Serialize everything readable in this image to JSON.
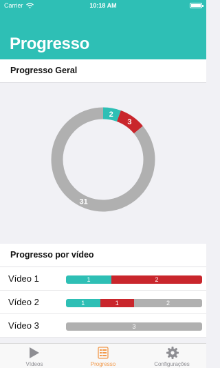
{
  "status_bar": {
    "carrier": "Carrier",
    "time": "10:18 AM"
  },
  "header": {
    "title": "Progresso"
  },
  "overall": {
    "title": "Progresso Geral",
    "segments": [
      {
        "value": 2,
        "label": "2",
        "color": "#2ebfb5"
      },
      {
        "value": 3,
        "label": "3",
        "color": "#c9262c"
      },
      {
        "value": 31,
        "label": "31",
        "color": "#b0b0b0"
      }
    ]
  },
  "videos": {
    "title": "Progresso por vídeo",
    "items": [
      {
        "label": "Vídeo 1",
        "segments": [
          {
            "value": 1,
            "label": "1",
            "color": "#2ebfb5"
          },
          {
            "value": 2,
            "label": "2",
            "color": "#c9262c"
          }
        ]
      },
      {
        "label": "Vídeo 2",
        "segments": [
          {
            "value": 1,
            "label": "1",
            "color": "#2ebfb5"
          },
          {
            "value": 1,
            "label": "1",
            "color": "#c9262c"
          },
          {
            "value": 2,
            "label": "2",
            "color": "#b0b0b0"
          }
        ]
      },
      {
        "label": "Vídeo 3",
        "segments": [
          {
            "value": 3,
            "label": "3",
            "color": "#b0b0b0"
          }
        ]
      }
    ]
  },
  "tabbar": {
    "tabs": [
      {
        "label": "Vídeos",
        "icon": "play-icon"
      },
      {
        "label": "Progresso",
        "icon": "list-icon",
        "active": true
      },
      {
        "label": "Configurações",
        "icon": "gear-icon"
      }
    ],
    "active_color": "#f2994a",
    "inactive_color": "#8e8e93"
  }
}
